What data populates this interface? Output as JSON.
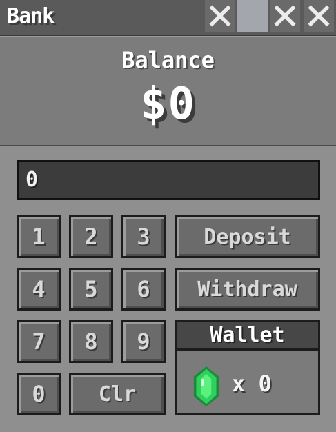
{
  "window": {
    "title": "Bank",
    "close_icon": "close-icon"
  },
  "balance": {
    "label": "Balance",
    "value": "$0"
  },
  "amount_input": {
    "value": "0"
  },
  "keypad": {
    "keys": [
      "1",
      "2",
      "3",
      "4",
      "5",
      "6",
      "7",
      "8",
      "9",
      "0"
    ],
    "clear_label": "Clr"
  },
  "actions": {
    "deposit_label": "Deposit",
    "withdraw_label": "Withdraw"
  },
  "wallet": {
    "title": "Wallet",
    "item_icon": "emerald-icon",
    "count_text": "x 0"
  },
  "colors": {
    "emerald": "#2fd15c",
    "panel": "#8f8f8f",
    "button": "#6b6b6b"
  }
}
